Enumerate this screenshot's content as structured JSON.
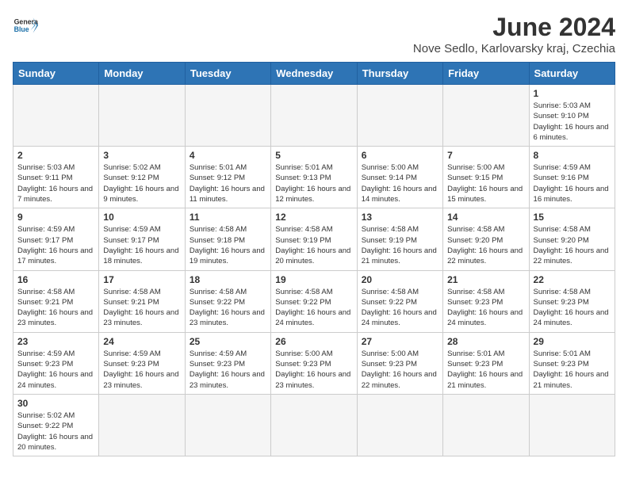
{
  "header": {
    "logo_general": "General",
    "logo_blue": "Blue",
    "title": "June 2024",
    "subtitle": "Nove Sedlo, Karlovarsky kraj, Czechia"
  },
  "columns": [
    "Sunday",
    "Monday",
    "Tuesday",
    "Wednesday",
    "Thursday",
    "Friday",
    "Saturday"
  ],
  "weeks": [
    [
      {
        "day": "",
        "info": ""
      },
      {
        "day": "",
        "info": ""
      },
      {
        "day": "",
        "info": ""
      },
      {
        "day": "",
        "info": ""
      },
      {
        "day": "",
        "info": ""
      },
      {
        "day": "",
        "info": ""
      },
      {
        "day": "1",
        "info": "Sunrise: 5:03 AM\nSunset: 9:10 PM\nDaylight: 16 hours and 6 minutes."
      }
    ],
    [
      {
        "day": "2",
        "info": "Sunrise: 5:03 AM\nSunset: 9:11 PM\nDaylight: 16 hours and 7 minutes."
      },
      {
        "day": "3",
        "info": "Sunrise: 5:02 AM\nSunset: 9:12 PM\nDaylight: 16 hours and 9 minutes."
      },
      {
        "day": "4",
        "info": "Sunrise: 5:01 AM\nSunset: 9:12 PM\nDaylight: 16 hours and 11 minutes."
      },
      {
        "day": "5",
        "info": "Sunrise: 5:01 AM\nSunset: 9:13 PM\nDaylight: 16 hours and 12 minutes."
      },
      {
        "day": "6",
        "info": "Sunrise: 5:00 AM\nSunset: 9:14 PM\nDaylight: 16 hours and 14 minutes."
      },
      {
        "day": "7",
        "info": "Sunrise: 5:00 AM\nSunset: 9:15 PM\nDaylight: 16 hours and 15 minutes."
      },
      {
        "day": "8",
        "info": "Sunrise: 4:59 AM\nSunset: 9:16 PM\nDaylight: 16 hours and 16 minutes."
      }
    ],
    [
      {
        "day": "9",
        "info": "Sunrise: 4:59 AM\nSunset: 9:17 PM\nDaylight: 16 hours and 17 minutes."
      },
      {
        "day": "10",
        "info": "Sunrise: 4:59 AM\nSunset: 9:17 PM\nDaylight: 16 hours and 18 minutes."
      },
      {
        "day": "11",
        "info": "Sunrise: 4:58 AM\nSunset: 9:18 PM\nDaylight: 16 hours and 19 minutes."
      },
      {
        "day": "12",
        "info": "Sunrise: 4:58 AM\nSunset: 9:19 PM\nDaylight: 16 hours and 20 minutes."
      },
      {
        "day": "13",
        "info": "Sunrise: 4:58 AM\nSunset: 9:19 PM\nDaylight: 16 hours and 21 minutes."
      },
      {
        "day": "14",
        "info": "Sunrise: 4:58 AM\nSunset: 9:20 PM\nDaylight: 16 hours and 22 minutes."
      },
      {
        "day": "15",
        "info": "Sunrise: 4:58 AM\nSunset: 9:20 PM\nDaylight: 16 hours and 22 minutes."
      }
    ],
    [
      {
        "day": "16",
        "info": "Sunrise: 4:58 AM\nSunset: 9:21 PM\nDaylight: 16 hours and 23 minutes."
      },
      {
        "day": "17",
        "info": "Sunrise: 4:58 AM\nSunset: 9:21 PM\nDaylight: 16 hours and 23 minutes."
      },
      {
        "day": "18",
        "info": "Sunrise: 4:58 AM\nSunset: 9:22 PM\nDaylight: 16 hours and 23 minutes."
      },
      {
        "day": "19",
        "info": "Sunrise: 4:58 AM\nSunset: 9:22 PM\nDaylight: 16 hours and 24 minutes."
      },
      {
        "day": "20",
        "info": "Sunrise: 4:58 AM\nSunset: 9:22 PM\nDaylight: 16 hours and 24 minutes."
      },
      {
        "day": "21",
        "info": "Sunrise: 4:58 AM\nSunset: 9:23 PM\nDaylight: 16 hours and 24 minutes."
      },
      {
        "day": "22",
        "info": "Sunrise: 4:58 AM\nSunset: 9:23 PM\nDaylight: 16 hours and 24 minutes."
      }
    ],
    [
      {
        "day": "23",
        "info": "Sunrise: 4:59 AM\nSunset: 9:23 PM\nDaylight: 16 hours and 24 minutes."
      },
      {
        "day": "24",
        "info": "Sunrise: 4:59 AM\nSunset: 9:23 PM\nDaylight: 16 hours and 23 minutes."
      },
      {
        "day": "25",
        "info": "Sunrise: 4:59 AM\nSunset: 9:23 PM\nDaylight: 16 hours and 23 minutes."
      },
      {
        "day": "26",
        "info": "Sunrise: 5:00 AM\nSunset: 9:23 PM\nDaylight: 16 hours and 23 minutes."
      },
      {
        "day": "27",
        "info": "Sunrise: 5:00 AM\nSunset: 9:23 PM\nDaylight: 16 hours and 22 minutes."
      },
      {
        "day": "28",
        "info": "Sunrise: 5:01 AM\nSunset: 9:23 PM\nDaylight: 16 hours and 21 minutes."
      },
      {
        "day": "29",
        "info": "Sunrise: 5:01 AM\nSunset: 9:23 PM\nDaylight: 16 hours and 21 minutes."
      }
    ],
    [
      {
        "day": "30",
        "info": "Sunrise: 5:02 AM\nSunset: 9:22 PM\nDaylight: 16 hours and 20 minutes."
      },
      {
        "day": "",
        "info": ""
      },
      {
        "day": "",
        "info": ""
      },
      {
        "day": "",
        "info": ""
      },
      {
        "day": "",
        "info": ""
      },
      {
        "day": "",
        "info": ""
      },
      {
        "day": "",
        "info": ""
      }
    ]
  ]
}
